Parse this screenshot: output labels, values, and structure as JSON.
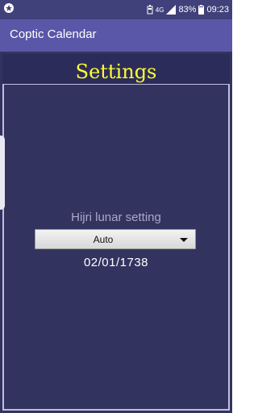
{
  "status_bar": {
    "network": "4G",
    "battery": "83%",
    "time": "09:23",
    "icons": [
      "app-notification-icon",
      "battery-saver-icon",
      "signal-icon",
      "battery-icon"
    ]
  },
  "app_bar": {
    "title": "Coptic Calendar"
  },
  "settings": {
    "title": "Settings",
    "hijri_label": "Hijri lunar setting",
    "dropdown_value": "Auto",
    "hijri_date": "02/01/1738"
  },
  "colors": {
    "status_bar": "#40407a",
    "app_bar": "#5a57a8",
    "content_bg": "#33335f",
    "title_yellow": "#ffff33"
  }
}
